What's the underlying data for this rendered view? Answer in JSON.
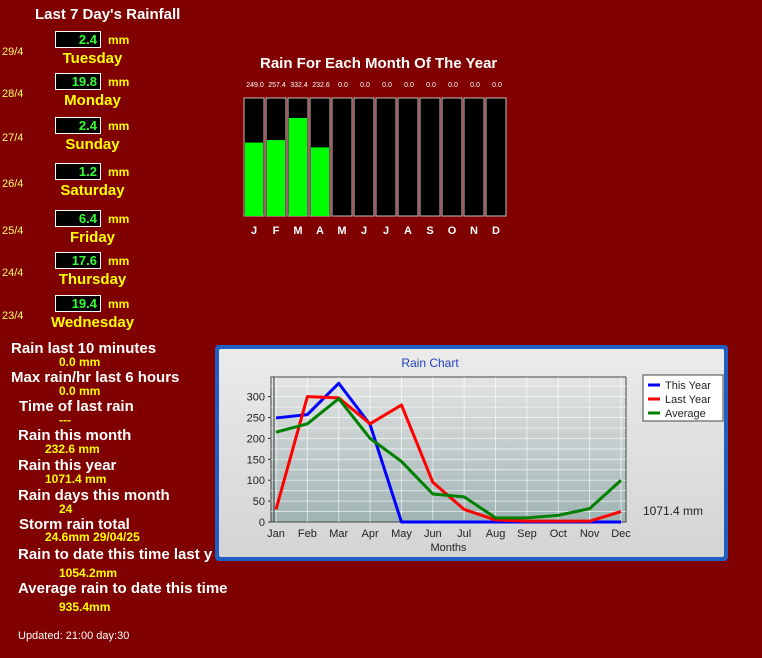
{
  "page": {
    "title": "Last 7 Day's Rainfall",
    "updated": "Updated: 21:00 day:30"
  },
  "colors": {
    "background": "#800000",
    "value_green": "#33ff33",
    "label_yellow": "#ffff00",
    "bar_green": "#00ff00"
  },
  "last7": [
    {
      "date": "29/4",
      "value": "2.4",
      "unit": "mm",
      "day": "Tuesday"
    },
    {
      "date": "28/4",
      "value": "19.8",
      "unit": "mm",
      "day": "Monday"
    },
    {
      "date": "27/4",
      "value": "2.4",
      "unit": "mm",
      "day": "Sunday"
    },
    {
      "date": "26/4",
      "value": "1.2",
      "unit": "mm",
      "day": "Saturday"
    },
    {
      "date": "25/4",
      "value": "6.4",
      "unit": "mm",
      "day": "Friday"
    },
    {
      "date": "24/4",
      "value": "17.6",
      "unit": "mm",
      "day": "Thursday"
    },
    {
      "date": "23/4",
      "value": "19.4",
      "unit": "mm",
      "day": "Wednesday"
    }
  ],
  "stats": [
    {
      "label": "Rain last 10 minutes",
      "value": "0.0 mm"
    },
    {
      "label": "Max rain/hr last 6 hours",
      "value": "0.0 mm"
    },
    {
      "label": "Time of last rain",
      "value": "---"
    },
    {
      "label": "Rain this month",
      "value": "232.6 mm"
    },
    {
      "label": "Rain this year",
      "value": "1071.4 mm"
    },
    {
      "label": "Rain days this month",
      "value": "24"
    },
    {
      "label": "Storm rain total",
      "value": "24.6mm 29/04/25"
    },
    {
      "label": "Rain to date this time last year",
      "value": "1054.2mm"
    },
    {
      "label": "Average rain to date this time",
      "value": "935.4mm"
    }
  ],
  "monthly": {
    "title": "Rain For Each Month Of The Year",
    "months": [
      "J",
      "F",
      "M",
      "A",
      "M",
      "J",
      "J",
      "A",
      "S",
      "O",
      "N",
      "D"
    ],
    "values": [
      249.0,
      257.4,
      332.4,
      232.6,
      0.0,
      0.0,
      0.0,
      0.0,
      0.0,
      0.0,
      0.0,
      0.0
    ],
    "labels": [
      "249.0",
      "257.4",
      "332.4",
      "232.6",
      "0.0",
      "0.0",
      "0.0",
      "0.0",
      "0.0",
      "0.0",
      "0.0",
      "0.0"
    ],
    "max": 400
  },
  "chart_data": {
    "type": "line",
    "title": "Rain Chart",
    "xlabel": "Months",
    "ylabel": "",
    "categories": [
      "Jan",
      "Feb",
      "Mar",
      "Apr",
      "May",
      "Jun",
      "Jul",
      "Aug",
      "Sep",
      "Oct",
      "Nov",
      "Dec"
    ],
    "ylim": [
      0,
      335
    ],
    "yticks": [
      0,
      50,
      100,
      150,
      200,
      250,
      300
    ],
    "grid": true,
    "legend": "top-right",
    "series": [
      {
        "name": "This Year",
        "color": "#0000ff",
        "values": [
          249,
          257,
          332,
          233,
          0,
          0,
          0,
          0,
          0,
          0,
          0,
          0
        ]
      },
      {
        "name": "Last Year",
        "color": "#ff0000",
        "values": [
          30,
          300,
          297,
          235,
          280,
          95,
          30,
          5,
          2,
          2,
          2,
          25
        ]
      },
      {
        "name": "Average",
        "color": "#008000",
        "values": [
          215,
          235,
          295,
          200,
          145,
          67,
          60,
          10,
          10,
          16,
          32,
          100
        ]
      }
    ],
    "annotation": "1071.4 mm"
  }
}
